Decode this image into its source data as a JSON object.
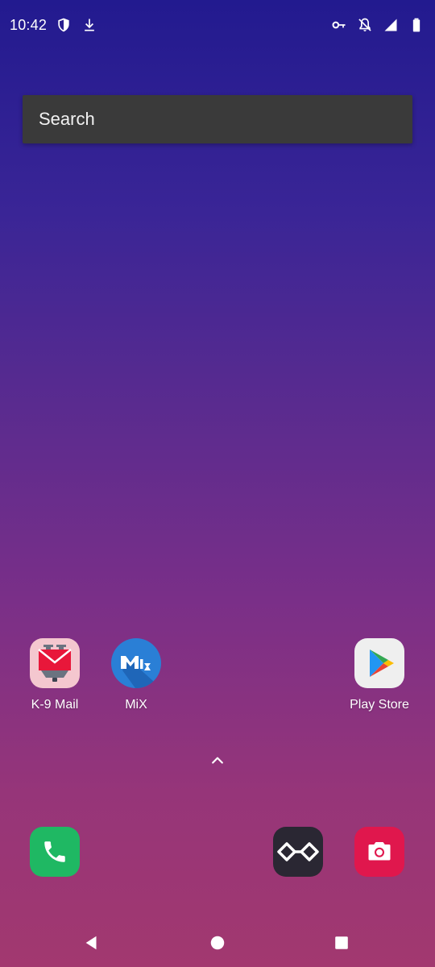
{
  "status_bar": {
    "time": "10:42",
    "left_icons": [
      "shield-icon",
      "download-icon"
    ],
    "right_icons": [
      "vpn-key-icon",
      "notifications-off-icon",
      "signal-icon",
      "battery-icon"
    ]
  },
  "search": {
    "placeholder": "Search"
  },
  "apps": [
    {
      "label": "K-9 Mail",
      "icon": "k9-mail-icon",
      "color": "#f4c7cf"
    },
    {
      "label": "MiX",
      "icon": "mix-icon",
      "color": "#2a7fd6"
    },
    {
      "label": "Play Store",
      "icon": "play-store-icon",
      "color": "#efefef"
    }
  ],
  "app_drawer_handle": "chevron-up-icon",
  "dock": [
    {
      "icon": "phone-icon",
      "color": "#1fb863"
    },
    {
      "icon": "infinity-app-icon",
      "color": "#2a2733"
    },
    {
      "icon": "camera-icon",
      "color": "#e0174d"
    }
  ],
  "nav_bar": [
    "back-icon",
    "home-icon",
    "recents-icon"
  ],
  "colors": {
    "wallpaper_top": "#221a8f",
    "wallpaper_bottom": "#a2386f",
    "search_bg": "#3a3a3a"
  }
}
